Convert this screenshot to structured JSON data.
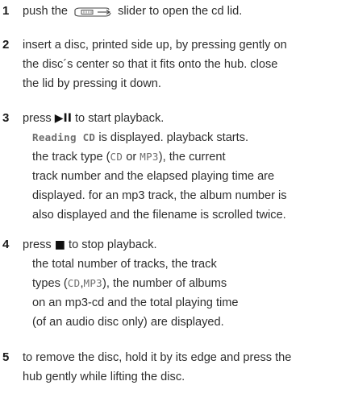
{
  "steps": [
    {
      "number": "1",
      "lines": [
        {
          "before": "push the",
          "after": "slider to open the cd lid.",
          "icon": "slider-icon"
        }
      ]
    },
    {
      "number": "2",
      "lines": [
        "insert a disc, printed side up, by pressing gently on",
        "the disc´s center so that it fits onto the hub. close",
        "the lid by pressing it down."
      ]
    },
    {
      "number": "3",
      "main": {
        "before": "press",
        "glyph": "▶II",
        "after": "to start playback."
      },
      "sub": {
        "line1_lcd": "Reading CD",
        "line1_rest": " is displayed. playback starts.",
        "line2_pre": "the track type (",
        "line2_cd": "CD",
        "line2_or": " or ",
        "line2_mp3": "MP3",
        "line2_post": "), the current",
        "lines": [
          "track number and the elapsed playing time are",
          "displayed. for an mp3 track, the album number is",
          "also displayed and the filename is scrolled twice."
        ]
      }
    },
    {
      "number": "4",
      "main": {
        "before": "press",
        "glyph": "■",
        "after": "to stop playback."
      },
      "sub": {
        "line1": "the total number of tracks, the track",
        "line2_pre": "types (",
        "line2_cd": "CD",
        "line2_sep": ",",
        "line2_mp3": "MP3",
        "line2_post": "), the number of albums",
        "lines": [
          "on an mp3-cd and the total playing time",
          "(of an audio disc only) are displayed."
        ]
      }
    },
    {
      "number": "5",
      "lines": [
        "to remove the disc, hold it by its edge and press the",
        "hub gently while lifting the disc."
      ]
    }
  ],
  "icons": {
    "slider": "slider-icon"
  }
}
